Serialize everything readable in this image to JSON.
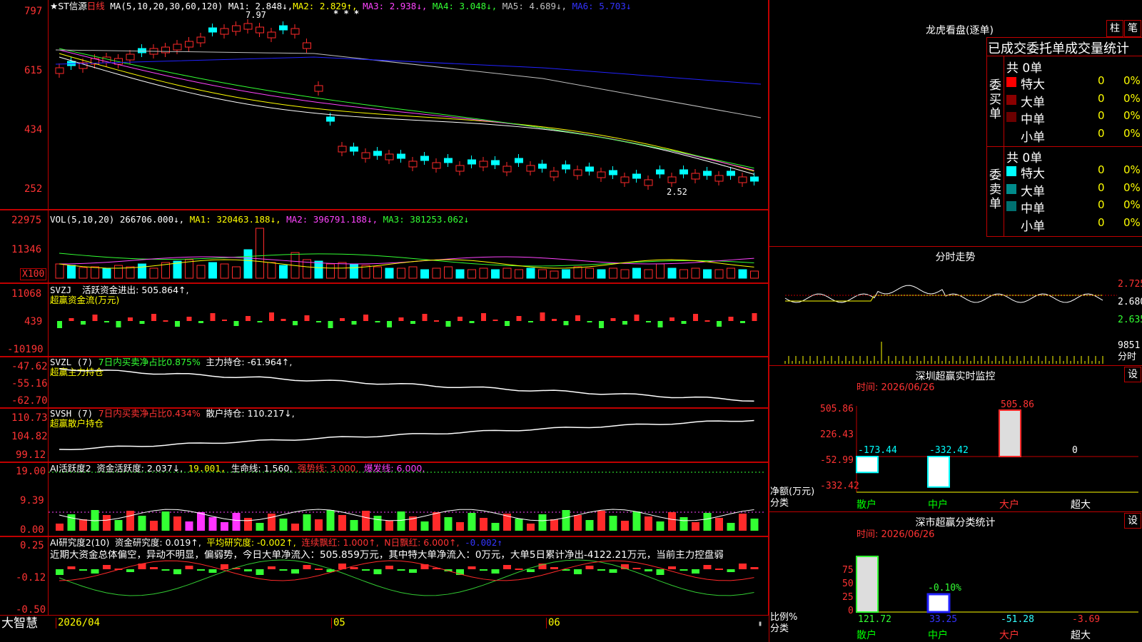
{
  "main_chart": {
    "stock_name": "★ST信源",
    "period": "日线",
    "ma_label": "MA(5,10,20,30,60,120)",
    "ma1": "MA1: 2.848↓,",
    "ma2": "MA2: 2.829↑,",
    "ma3": "MA3: 2.938↓,",
    "ma4": "MA4: 3.048↓,",
    "ma5": "MA5: 4.689↓,",
    "ma6": "MA6: 5.703↓",
    "y_ticks": [
      "797",
      "615",
      "434",
      "252"
    ],
    "high_mark": "7.97",
    "low_mark": "2.52",
    "stars": "* * *"
  },
  "vol_panel": {
    "label": "VOL(5,10,20)",
    "value": "266706.000↓,",
    "ma1": "MA1: 320463.188↓,",
    "ma2": "MA2: 396791.188↓,",
    "ma3": "MA3: 381253.062↓",
    "y_ticks": [
      "22975",
      "11346"
    ],
    "unit": "X100"
  },
  "svzj_panel": {
    "label": "SVZJ",
    "value": "活跃资金进出: 505.864↑,",
    "subtitle": "超赢资金流(万元)",
    "y_ticks": [
      "11068",
      "439",
      "-10190"
    ]
  },
  "svzl_panel": {
    "label": "SVZL (7)",
    "ratio": "7日内买卖净占比0.875%",
    "value": "主力持仓: -61.964↑,",
    "subtitle": "超赢主力持仓",
    "y_ticks": [
      "-47.62",
      "-55.16",
      "-62.70"
    ]
  },
  "svsh_panel": {
    "label": "SVSH (7)",
    "ratio": "7日内买卖净占比0.434%",
    "value": "散户持仓: 110.217↓,",
    "subtitle": "超赢散户持仓",
    "y_ticks": [
      "110.73",
      "104.82",
      "99.12"
    ]
  },
  "ai_active_panel": {
    "label": "AI活跃度2",
    "value1": "资金活跃度: 2.037↓,",
    "value2": "19.001,",
    "value3": "生命线: 1.560,",
    "value4": "强势线: 3.000,",
    "value5": "爆发线: 6.000,",
    "y_ticks": [
      "19.00",
      "9.39",
      "0.00"
    ]
  },
  "ai_research_panel": {
    "label": "AI研究度2(10)",
    "value1": "资金研究度: 0.019↑,",
    "value2": "平均研究度: -0.002↑,",
    "value3": "连续飘红: 1.000↑,",
    "value4": "N日飘红: 6.000↑,",
    "value5": "-0.002↑",
    "commentary": "近期大资金总体偏空，异动不明显，偏弱势，今日大单净流入：505.859万元，其中特大单净流入：0万元，大单5日累计净出-4122.21万元，当前主力控盘弱",
    "y_ticks": [
      "0.25",
      "-0.12",
      "-0.50"
    ]
  },
  "x_axis": {
    "brand": "大智慧",
    "date_start": "2026/04",
    "month_5": "05",
    "month_6": "06"
  },
  "dragon_tiger": {
    "title": "龙虎看盘(逐单)",
    "btn_bar": "柱",
    "btn_stroke": "笔",
    "header": "已成交委托单成交量统计",
    "buy_group_label": "委买单",
    "buy_total": "共 0单",
    "sell_group_label": "委卖单",
    "sell_total": "共 0单",
    "buy_rows": [
      {
        "name": "特大",
        "count": "0",
        "pct": "0%",
        "color": "#ff0000"
      },
      {
        "name": "大单",
        "count": "0",
        "pct": "0%",
        "color": "#8b0000"
      },
      {
        "name": "中单",
        "count": "0",
        "pct": "0%",
        "color": "#6b0000"
      },
      {
        "name": "小单",
        "count": "0",
        "pct": "0%",
        "color": "#000000"
      }
    ],
    "sell_rows": [
      {
        "name": "特大",
        "count": "0",
        "pct": "0%",
        "color": "#00ffff"
      },
      {
        "name": "大单",
        "count": "0",
        "pct": "0%",
        "color": "#008b8b"
      },
      {
        "name": "中单",
        "count": "0",
        "pct": "0%",
        "color": "#007070"
      },
      {
        "name": "小单",
        "count": "0",
        "pct": "0%",
        "color": "#000000"
      }
    ]
  },
  "intraday": {
    "title": "分时走势",
    "y_ticks": [
      "2.725",
      "2.680",
      "2.635"
    ],
    "vol_label": "9851",
    "vol_unit": "分时"
  },
  "sz_monitor": {
    "title": "深圳超赢实时监控",
    "btn": "设",
    "time": "时间: 2026/06/26",
    "y_ticks": [
      "505.86",
      "226.43",
      "-52.99",
      "-332.42"
    ],
    "y_label": "净额(万元)",
    "x_label": "分类",
    "categories": [
      "散户",
      "中户",
      "大户",
      "超大"
    ],
    "values": [
      -173.44,
      -332.42,
      505.86,
      0
    ],
    "value_labels": [
      "-173.44",
      "-332.42",
      "505.86",
      "0"
    ]
  },
  "market_stats": {
    "title": "深市超赢分类统计",
    "btn": "设",
    "time": "时间: 2026/06/26",
    "y_ticks": [
      "75",
      "50",
      "25",
      "0"
    ],
    "y_label": "比例%",
    "x_label": "分类",
    "categories": [
      "散户",
      "中户",
      "大户",
      "超大"
    ],
    "bar_label": "-0.10%",
    "values": [
      "121.72",
      "33.25",
      "-51.28",
      "-3.69"
    ]
  }
}
